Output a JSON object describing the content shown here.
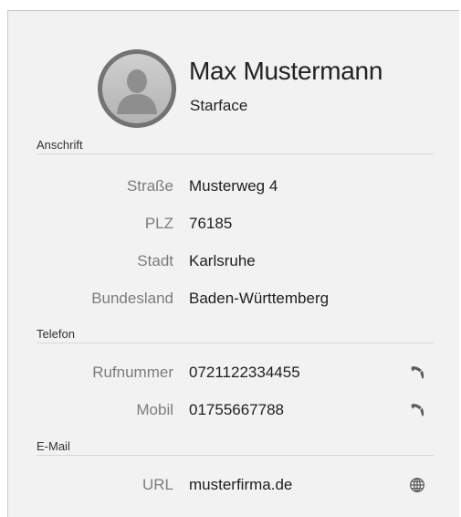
{
  "contact": {
    "name": "Max Mustermann",
    "company": "Starface"
  },
  "sections": {
    "address": {
      "header": "Anschrift",
      "rows": [
        {
          "label": "Straße",
          "value": "Musterweg 4"
        },
        {
          "label": "PLZ",
          "value": "76185"
        },
        {
          "label": "Stadt",
          "value": "Karlsruhe"
        },
        {
          "label": "Bundesland",
          "value": "Baden-Württemberg"
        }
      ]
    },
    "phone": {
      "header": "Telefon",
      "rows": [
        {
          "label": "Rufnummer",
          "value": "0721122334455",
          "icon": "phone-icon"
        },
        {
          "label": "Mobil",
          "value": "01755667788",
          "icon": "phone-icon"
        }
      ]
    },
    "email": {
      "header": "E-Mail",
      "rows": [
        {
          "label": "URL",
          "value": "musterfirma.de",
          "icon": "globe-icon"
        }
      ]
    }
  },
  "colors": {
    "panel_background": "#f2f2f2",
    "label_text": "#7c7c7c",
    "value_text": "#1e1e1e",
    "avatar_ring": "#737373"
  }
}
